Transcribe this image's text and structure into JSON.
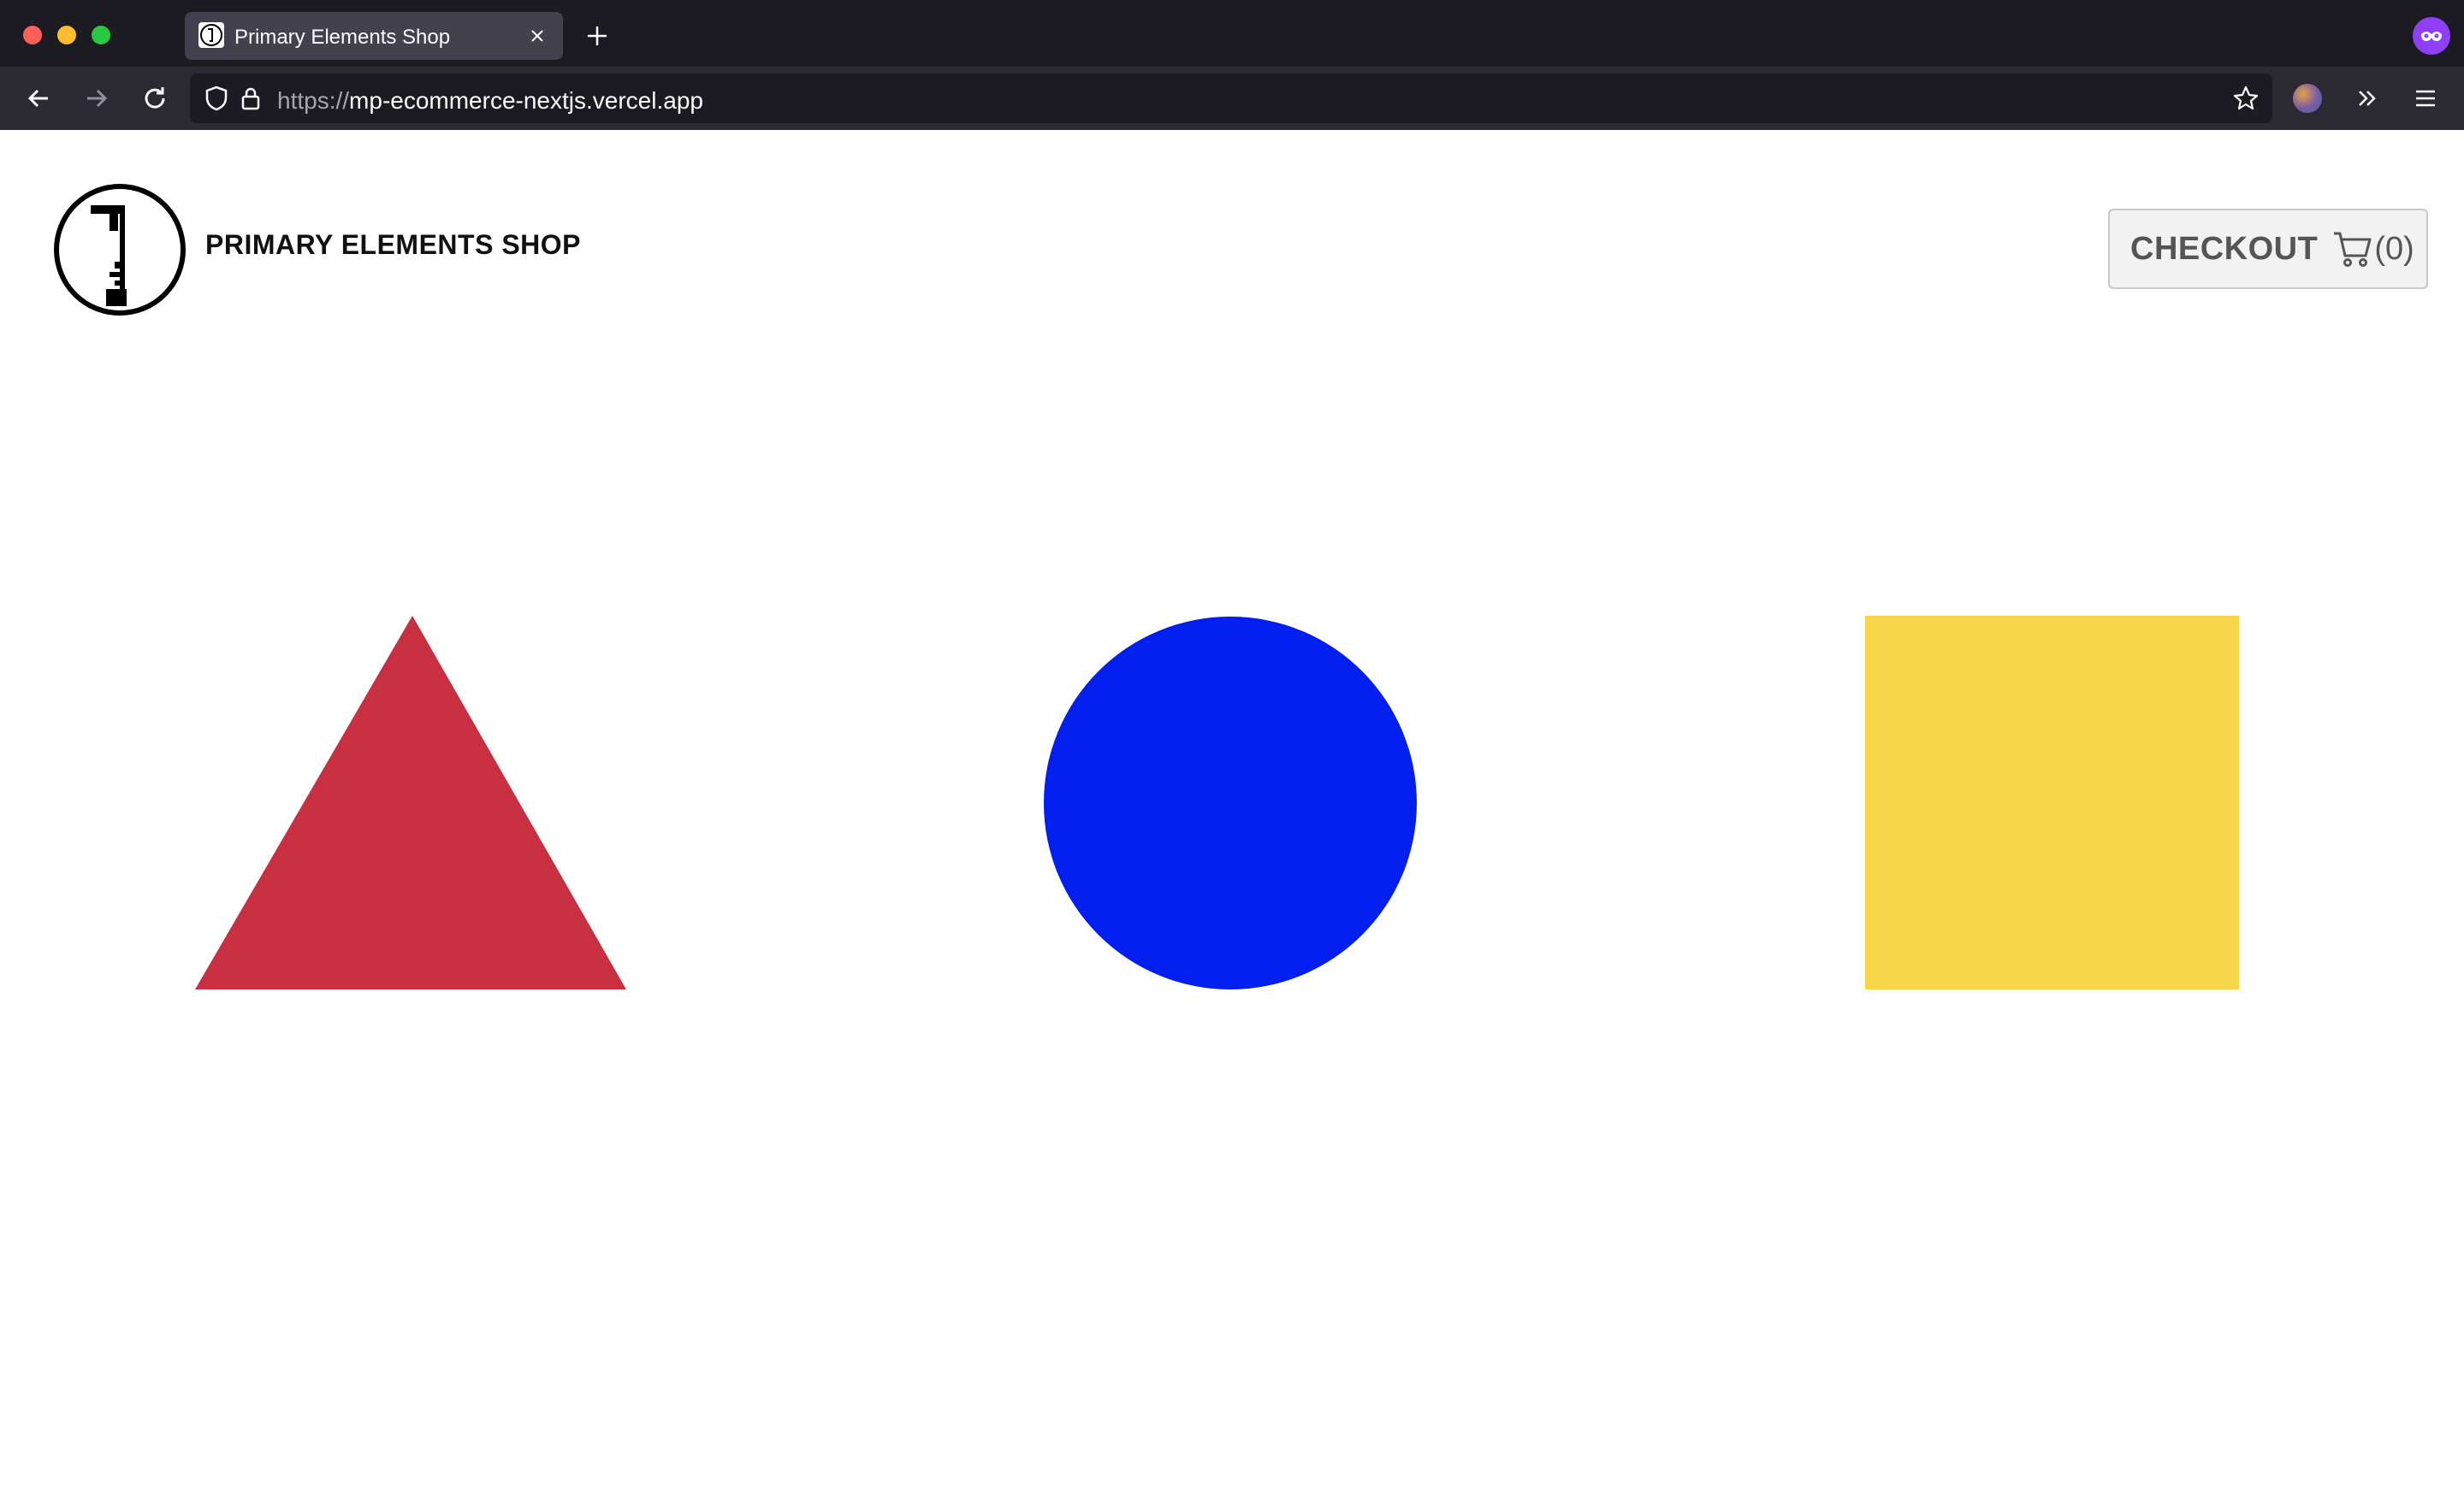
{
  "browser": {
    "tab_title": "Primary Elements Shop",
    "url_scheme": "https://",
    "url_host": "mp-ecommerce-nextjs.vercel.app"
  },
  "header": {
    "brand": "PRIMARY ELEMENTS SHOP",
    "checkout_label": "CHECKOUT",
    "cart_count": "(0)",
    "logo_icon": "bauhaus-face-logo-icon",
    "cart_icon": "shopping-cart-icon"
  },
  "products": [
    {
      "shape": "triangle",
      "color": "#c83042"
    },
    {
      "shape": "circle",
      "color": "#031ff0"
    },
    {
      "shape": "square",
      "color": "#f8d64a"
    }
  ]
}
